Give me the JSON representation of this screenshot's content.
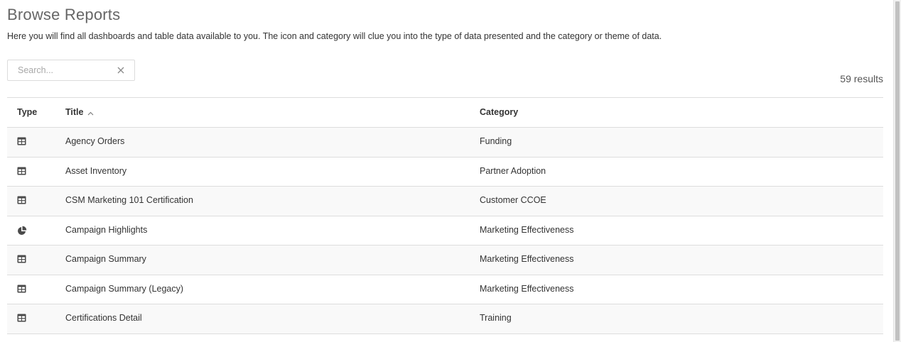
{
  "header": {
    "title": "Browse Reports",
    "description": "Here you will find all dashboards and table data available to you. The icon and category will clue you into the type of data presented and the category or theme of data."
  },
  "search": {
    "placeholder": "Search...",
    "value": "",
    "clear_icon": "close-icon"
  },
  "results": {
    "count_label": "59 results"
  },
  "table": {
    "columns": {
      "type": "Type",
      "title": "Title",
      "category": "Category"
    },
    "sort": {
      "column": "Title",
      "direction": "ascending",
      "icon": "chevron-up-icon"
    },
    "rows": [
      {
        "type": "table",
        "icon": "table-icon",
        "title": "Agency Orders",
        "category": "Funding"
      },
      {
        "type": "table",
        "icon": "table-icon",
        "title": "Asset Inventory",
        "category": "Partner Adoption"
      },
      {
        "type": "table",
        "icon": "table-icon",
        "title": "CSM Marketing 101 Certification",
        "category": "Customer CCOE"
      },
      {
        "type": "dashboard",
        "icon": "pie-chart-icon",
        "title": "Campaign Highlights",
        "category": "Marketing Effectiveness"
      },
      {
        "type": "table",
        "icon": "table-icon",
        "title": "Campaign Summary",
        "category": "Marketing Effectiveness"
      },
      {
        "type": "table",
        "icon": "table-icon",
        "title": "Campaign Summary (Legacy)",
        "category": "Marketing Effectiveness"
      },
      {
        "type": "table",
        "icon": "table-icon",
        "title": "Certifications Detail",
        "category": "Training"
      }
    ]
  },
  "colors": {
    "icon": "#4a4a4a",
    "border": "#dddddd",
    "stripe": "#f9f9f9"
  }
}
